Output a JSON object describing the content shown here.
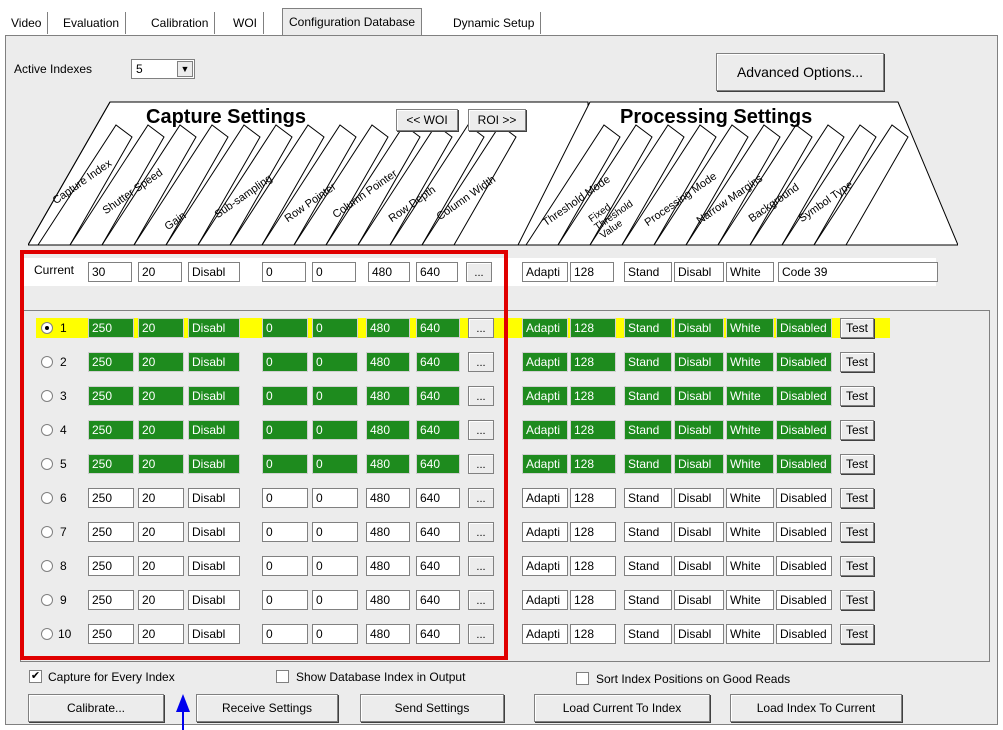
{
  "tabs": [
    "Video",
    "Evaluation",
    "Calibration",
    "WOI",
    "Configuration Database",
    "Dynamic Setup"
  ],
  "active_indexes": {
    "label": "Active Indexes",
    "value": "5"
  },
  "advanced_button": "Advanced Options...",
  "capture_title": "Capture Settings",
  "processing_title": "Processing Settings",
  "woi_button": "<< WOI",
  "roi_button": "ROI >>",
  "capture_columns": [
    "Capture Index",
    "Shutter Speed",
    "Gain",
    "Sub-sampling",
    "Row Pointer",
    "Column Pointer",
    "Row Depth",
    "Column Width"
  ],
  "processing_columns": [
    "Threshold Mode",
    "Fixed Threshold Value",
    "Processing Mode",
    "Narrow Margins",
    "Background",
    "Symbol Type"
  ],
  "current": {
    "label": "Current",
    "capture": [
      "30",
      "20",
      "Disabl",
      "0",
      "0",
      "480",
      "640"
    ],
    "processing": [
      "Adapti",
      "128",
      "Stand",
      "Disabl",
      "White",
      "Code 39"
    ]
  },
  "dots_label": "...",
  "test_label": "Test",
  "rows": [
    {
      "index": "1",
      "selected": true,
      "active": true,
      "capture": [
        "250",
        "20",
        "Disabl",
        "0",
        "0",
        "480",
        "640"
      ],
      "processing": [
        "Adapti",
        "128",
        "Stand",
        "Disabl",
        "White",
        "Disabled"
      ]
    },
    {
      "index": "2",
      "selected": false,
      "active": true,
      "capture": [
        "250",
        "20",
        "Disabl",
        "0",
        "0",
        "480",
        "640"
      ],
      "processing": [
        "Adapti",
        "128",
        "Stand",
        "Disabl",
        "White",
        "Disabled"
      ]
    },
    {
      "index": "3",
      "selected": false,
      "active": true,
      "capture": [
        "250",
        "20",
        "Disabl",
        "0",
        "0",
        "480",
        "640"
      ],
      "processing": [
        "Adapti",
        "128",
        "Stand",
        "Disabl",
        "White",
        "Disabled"
      ]
    },
    {
      "index": "4",
      "selected": false,
      "active": true,
      "capture": [
        "250",
        "20",
        "Disabl",
        "0",
        "0",
        "480",
        "640"
      ],
      "processing": [
        "Adapti",
        "128",
        "Stand",
        "Disabl",
        "White",
        "Disabled"
      ]
    },
    {
      "index": "5",
      "selected": false,
      "active": true,
      "capture": [
        "250",
        "20",
        "Disabl",
        "0",
        "0",
        "480",
        "640"
      ],
      "processing": [
        "Adapti",
        "128",
        "Stand",
        "Disabl",
        "White",
        "Disabled"
      ]
    },
    {
      "index": "6",
      "selected": false,
      "active": false,
      "capture": [
        "250",
        "20",
        "Disabl",
        "0",
        "0",
        "480",
        "640"
      ],
      "processing": [
        "Adapti",
        "128",
        "Stand",
        "Disabl",
        "White",
        "Disabled"
      ]
    },
    {
      "index": "7",
      "selected": false,
      "active": false,
      "capture": [
        "250",
        "20",
        "Disabl",
        "0",
        "0",
        "480",
        "640"
      ],
      "processing": [
        "Adapti",
        "128",
        "Stand",
        "Disabl",
        "White",
        "Disabled"
      ]
    },
    {
      "index": "8",
      "selected": false,
      "active": false,
      "capture": [
        "250",
        "20",
        "Disabl",
        "0",
        "0",
        "480",
        "640"
      ],
      "processing": [
        "Adapti",
        "128",
        "Stand",
        "Disabl",
        "White",
        "Disabled"
      ]
    },
    {
      "index": "9",
      "selected": false,
      "active": false,
      "capture": [
        "250",
        "20",
        "Disabl",
        "0",
        "0",
        "480",
        "640"
      ],
      "processing": [
        "Adapti",
        "128",
        "Stand",
        "Disabl",
        "White",
        "Disabled"
      ]
    },
    {
      "index": "10",
      "selected": false,
      "active": false,
      "capture": [
        "250",
        "20",
        "Disabl",
        "0",
        "0",
        "480",
        "640"
      ],
      "processing": [
        "Adapti",
        "128",
        "Stand",
        "Disabl",
        "White",
        "Disabled"
      ]
    }
  ],
  "checkboxes": {
    "capture_every": {
      "label": "Capture for Every Index",
      "checked": true
    },
    "show_db_index": {
      "label": "Show Database Index in Output",
      "checked": false
    },
    "sort_index": {
      "label": "Sort Index Positions on Good Reads",
      "checked": false
    }
  },
  "buttons": {
    "calibrate": "Calibrate...",
    "receive": "Receive Settings",
    "send": "Send Settings",
    "load_current_to_index": "Load Current To Index",
    "load_index_to_current": "Load Index To Current"
  },
  "colors": {
    "active_field": "#1e8b1e",
    "selected_row": "#ffff00",
    "annotation_box": "#e00000",
    "annotation_arrow": "#0000ee"
  }
}
